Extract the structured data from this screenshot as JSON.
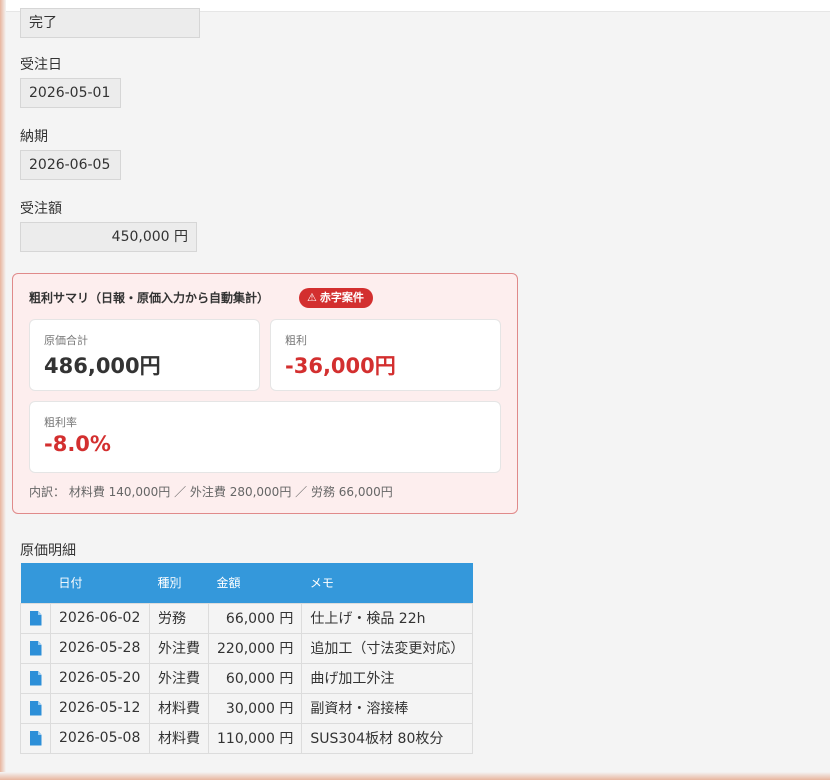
{
  "fields": {
    "status": {
      "value": "完了"
    },
    "order_date": {
      "label": "受注日",
      "value": "2026-05-01"
    },
    "delivery": {
      "label": "納期",
      "value": "2026-06-05"
    },
    "order_amount": {
      "label": "受注額",
      "value": "450,000 円"
    }
  },
  "summary": {
    "title": "粗利サマリ（日報・原価入力から自動集計）",
    "badge": "赤字案件",
    "badge_icon": "warning-triangle-icon",
    "cost_total": {
      "label": "原価合計",
      "value": "486,000円"
    },
    "gross_profit": {
      "label": "粗利",
      "value": "-36,000円"
    },
    "margin": {
      "label": "粗利率",
      "value": "-8.0%"
    },
    "breakdown": "内訳： 材料費 140,000円 ／ 外注費 280,000円 ／ 労務 66,000円",
    "colors": {
      "negative": "#d32f2f",
      "panel_bg": "#fdeeee",
      "panel_border": "#e08a8a"
    }
  },
  "cost_detail": {
    "title": "原価明細",
    "header_color": "#3498db",
    "columns": [
      "",
      "日付",
      "種別",
      "金額",
      "メモ"
    ],
    "rows": [
      {
        "date": "2026-06-02",
        "type": "労務",
        "amount": "66,000 円",
        "memo": "仕上げ・検品 22h"
      },
      {
        "date": "2026-05-28",
        "type": "外注費",
        "amount": "220,000 円",
        "memo": "追加工（寸法変更対応）"
      },
      {
        "date": "2026-05-20",
        "type": "外注費",
        "amount": "60,000 円",
        "memo": "曲げ加工外注"
      },
      {
        "date": "2026-05-12",
        "type": "材料費",
        "amount": "30,000 円",
        "memo": "副資材・溶接棒"
      },
      {
        "date": "2026-05-08",
        "type": "材料費",
        "amount": "110,000 円",
        "memo": "SUS304板材 80枚分"
      }
    ]
  }
}
